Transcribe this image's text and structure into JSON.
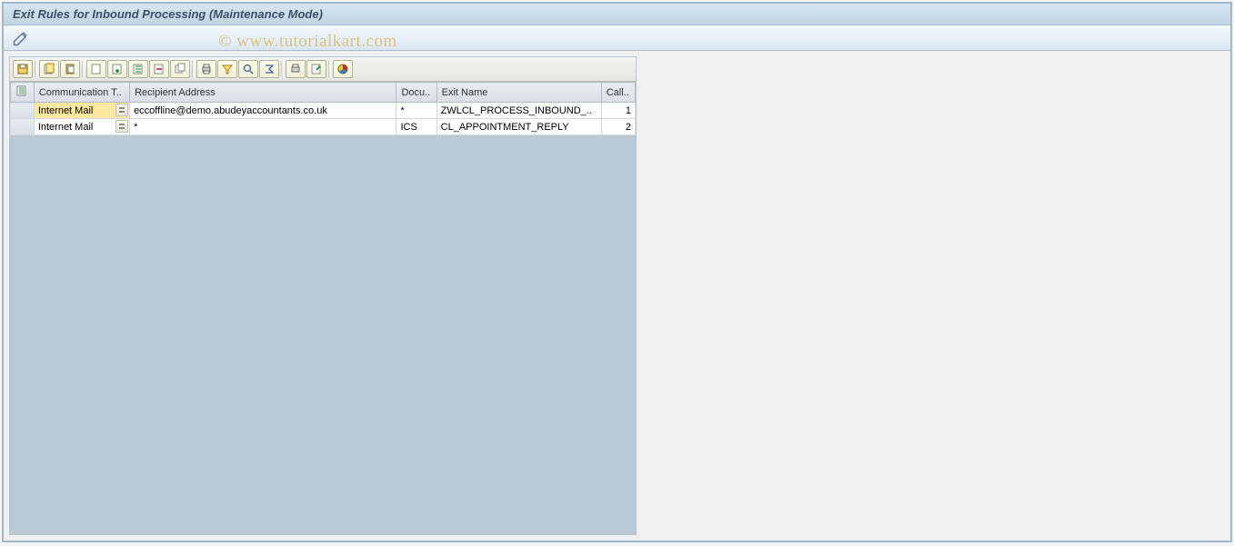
{
  "window": {
    "title": "Exit Rules for Inbound Processing (Maintenance Mode)"
  },
  "watermark": "© www.tutorialkart.com",
  "grid": {
    "headers": {
      "comm": "Communication T..",
      "recip": "Recipient Address",
      "docu": "Docu..",
      "exit": "Exit Name",
      "call": "Call.."
    },
    "rows": [
      {
        "comm": "Internet Mail",
        "recip": "eccoffline@demo.abudeyaccountants.co.uk",
        "docu": "*",
        "exit": "ZWLCL_PROCESS_INBOUND_..",
        "call": "1",
        "selected": true
      },
      {
        "comm": "Internet Mail",
        "recip": "*",
        "docu": "ICS",
        "exit": "CL_APPOINTMENT_REPLY",
        "call": "2",
        "selected": false
      }
    ]
  },
  "toolbar_icons": {
    "app_edit": "edit-pencil-icon",
    "save": "save-icon",
    "copy": "copy-icon",
    "paste": "paste-icon",
    "new": "new-icon",
    "insert": "insert-row-icon",
    "delete": "delete-row-icon",
    "duplicate": "duplicate-icon",
    "print": "print-icon",
    "filter": "filter-icon",
    "find": "find-icon",
    "sum": "sum-icon",
    "export": "export-icon",
    "layout": "layout-icon",
    "graph": "graph-icon"
  }
}
